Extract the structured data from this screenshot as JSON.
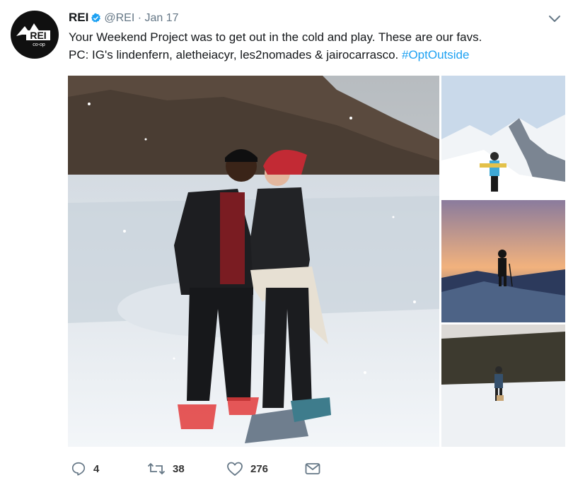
{
  "tweet": {
    "account_name": "REI",
    "handle": "@REI",
    "separator": "·",
    "date": "Jan 17",
    "text_line1": "Your Weekend Project was to get out in the cold and play. These are our favs.",
    "text_line2_prefix": "PC: IG's lindenfern, aletheiacyr, les2nomades & jairocarrasco. ",
    "hashtag": "#OptOutside"
  },
  "avatar": {
    "logo_text": "REI",
    "logo_subtext": "co-op"
  },
  "actions": {
    "reply_count": "4",
    "retweet_count": "38",
    "like_count": "276"
  },
  "colors": {
    "link": "#1da1f2",
    "muted": "#657786",
    "text": "#14171a",
    "verified": "#1da1f2"
  },
  "icons": [
    "verified-badge-icon",
    "chevron-down-icon",
    "reply-icon",
    "retweet-icon",
    "heart-icon",
    "envelope-icon"
  ]
}
